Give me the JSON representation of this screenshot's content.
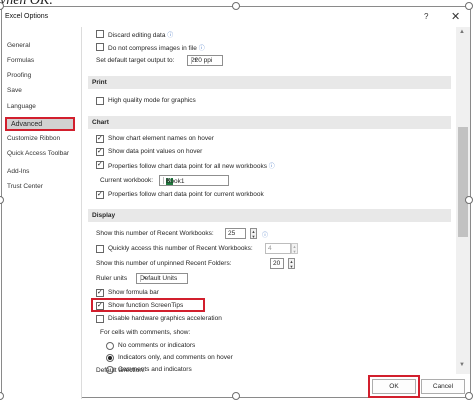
{
  "doc_fragment": "vhen OK.",
  "window": {
    "title": "Excel Options",
    "help": "?",
    "close": "✕"
  },
  "sidebar": {
    "items": [
      {
        "label": "General"
      },
      {
        "label": "Formulas"
      },
      {
        "label": "Proofing"
      },
      {
        "label": "Save"
      },
      {
        "label": "Language"
      },
      {
        "label": "Advanced"
      },
      {
        "label": "Customize Ribbon"
      },
      {
        "label": "Quick Access Toolbar"
      },
      {
        "label": "Add-Ins"
      },
      {
        "label": "Trust Center"
      }
    ],
    "selected": "Advanced"
  },
  "image_size": {
    "discard_editing": "Discard editing data",
    "no_compress": "Do not compress images in file",
    "target_label": "Set default target output to:",
    "target_value": "220 ppi"
  },
  "print": {
    "header": "Print",
    "high_quality": "High quality mode for graphics"
  },
  "chart": {
    "header": "Chart",
    "element_names": "Show chart element names on hover",
    "point_values": "Show data point values on hover",
    "props_all": "Properties follow chart data point for all new workbooks",
    "workbook_label": "Current workbook:",
    "workbook_value": "Book1",
    "workbook_icon": "X",
    "props_current": "Properties follow chart data point for current workbook"
  },
  "display": {
    "header": "Display",
    "recent_workbooks_label": "Show this number of Recent Workbooks:",
    "recent_workbooks_value": "25",
    "quick_access_label": "Quickly access this number of Recent Workbooks:",
    "quick_access_value": "4",
    "unpinned_folders_label": "Show this number of unpinned Recent Folders:",
    "unpinned_folders_value": "20",
    "ruler_label": "Ruler units",
    "ruler_value": "Default Units",
    "formula_bar": "Show formula bar",
    "screentips": "Show function ScreenTips",
    "disable_hw": "Disable hardware graphics acceleration",
    "comments_label": "For cells with comments, show:",
    "no_comments": "No comments or indicators",
    "indicators_only": "Indicators only, and comments on hover",
    "comments_indicators": "Comments and indicators",
    "default_direction": "Default direction:"
  },
  "buttons": {
    "ok": "OK",
    "cancel": "Cancel"
  },
  "icons": {
    "info": "ⓘ",
    "dropdown": "▾",
    "spin_up": "▲",
    "spin_down": "▼",
    "scroll_up": "▲",
    "scroll_down": "▼"
  }
}
